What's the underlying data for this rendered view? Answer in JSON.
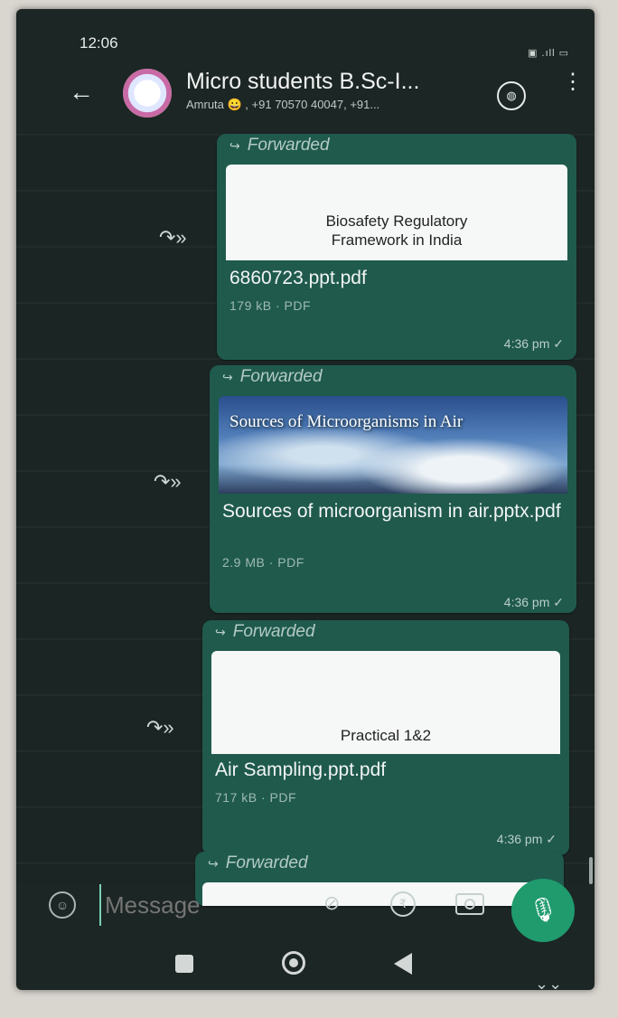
{
  "status_bar": {
    "time": "12:06",
    "indicators": "▣ .ıll ▭"
  },
  "header": {
    "back_icon": "←",
    "title": "Micro students B.Sc-I...",
    "subtitle": "Amruta 😀 , +91 70570 40047, +91...",
    "call_icon": "◍",
    "menu_icon": "⋮"
  },
  "messages": [
    {
      "forwarded_label": "Forwarded",
      "preview_title": "Biosafety Regulatory\nFramework in India",
      "file_name": "6860723.ppt.pdf",
      "file_meta": "179 kB · PDF",
      "time": "4:36 pm ✓"
    },
    {
      "forwarded_label": "Forwarded",
      "preview_image_text": "Sources of Microorganisms in Air",
      "file_name": "Sources of microorganism in air.pptx.pdf",
      "file_meta": "2.9 MB · PDF",
      "time": "4:36 pm ✓"
    },
    {
      "forwarded_label": "Forwarded",
      "preview_title": "Practical 1&2",
      "file_name": "Air Sampling.ppt.pdf",
      "file_meta": "717 kB · PDF",
      "time": "4:36 pm ✓"
    },
    {
      "forwarded_label": "Forwarded"
    }
  ],
  "forward_arrow": "↷»",
  "input": {
    "placeholder": "Message",
    "emoji_icon": "☺",
    "attach_icon": "⊘",
    "rupee_icon": "₹",
    "mic_icon": "🎙"
  },
  "scroll_down_icon": "⌄⌄",
  "colors": {
    "bubble": "#1f5a4d",
    "chat_bg": "#1b2523",
    "mic": "#1f9b6e"
  }
}
